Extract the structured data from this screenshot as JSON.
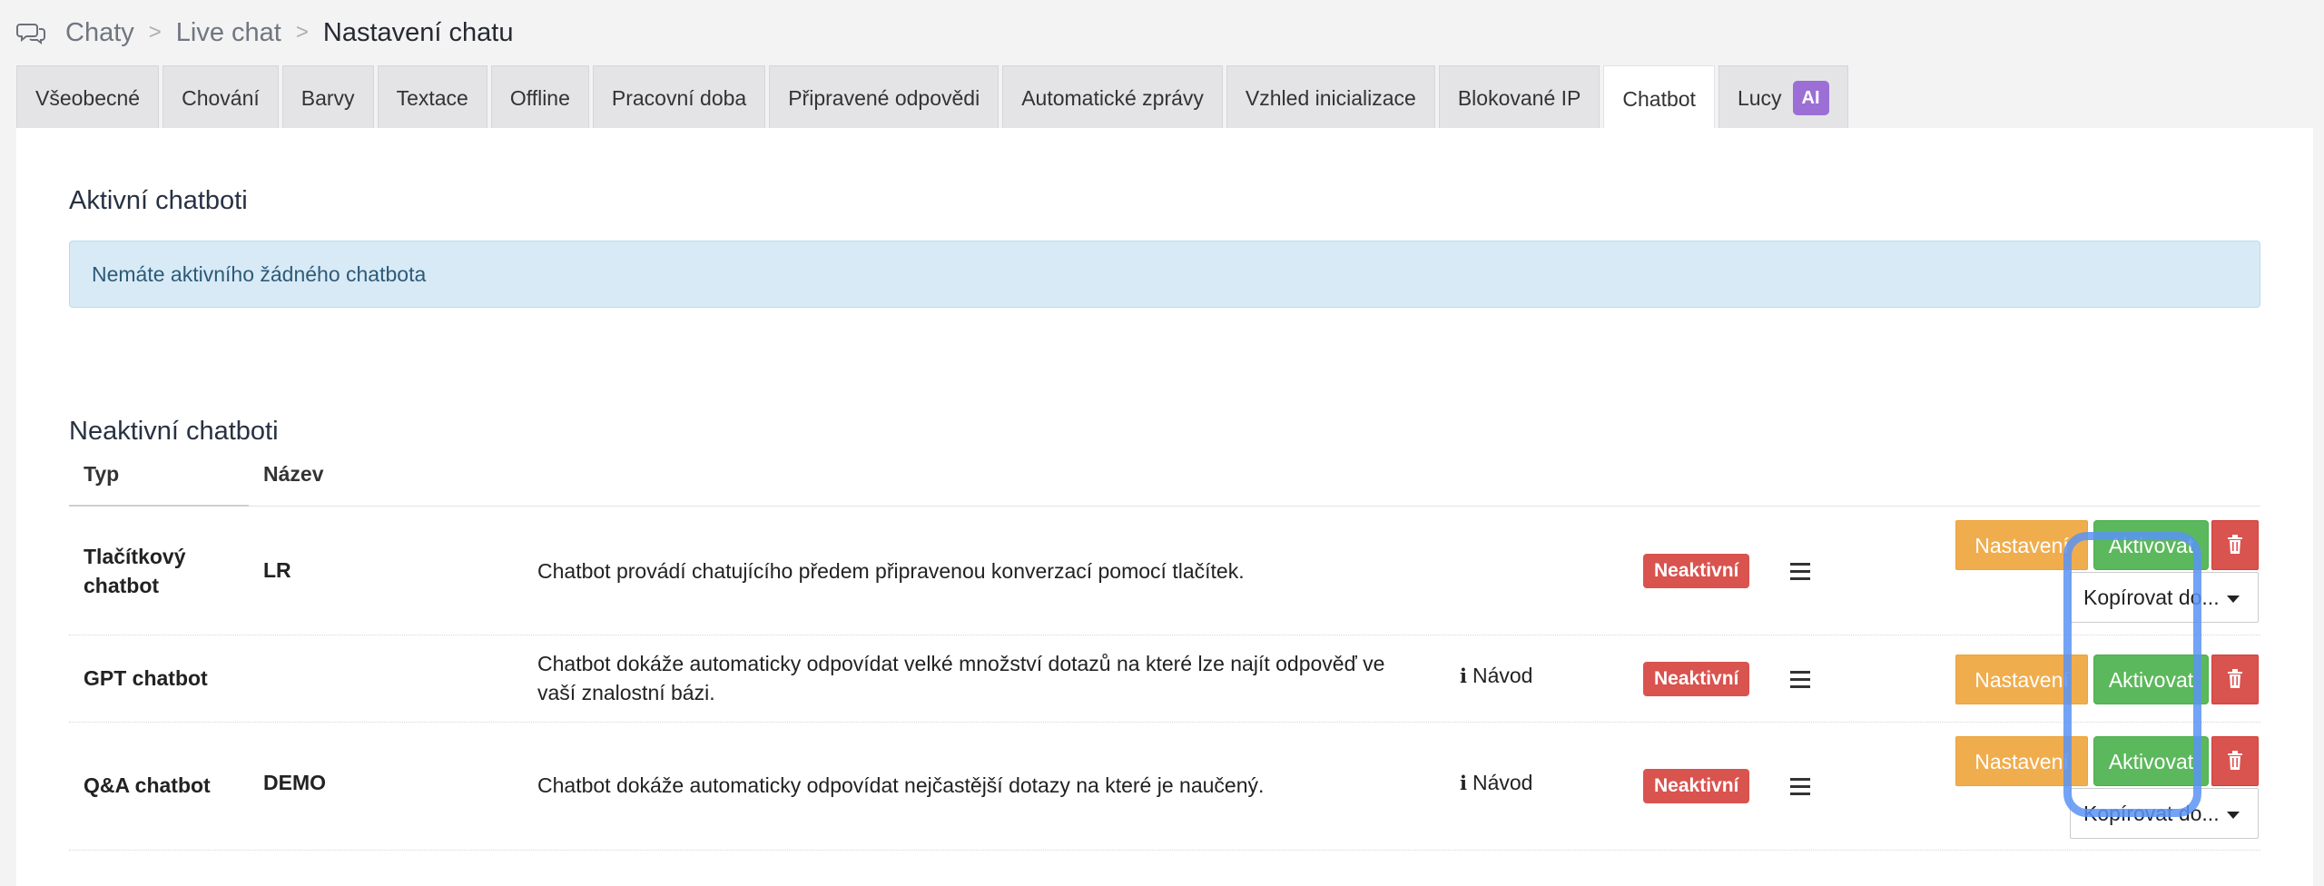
{
  "breadcrumb": {
    "items": [
      "Chaty",
      "Live chat"
    ],
    "current": "Nastavení chatu",
    "separator": ">"
  },
  "tabs": [
    {
      "label": "Všeobecné"
    },
    {
      "label": "Chování"
    },
    {
      "label": "Barvy"
    },
    {
      "label": "Textace"
    },
    {
      "label": "Offline"
    },
    {
      "label": "Pracovní doba"
    },
    {
      "label": "Připravené odpovědi"
    },
    {
      "label": "Automatické zprávy"
    },
    {
      "label": "Vzhled inicializace"
    },
    {
      "label": "Blokované IP"
    },
    {
      "label": "Chatbot",
      "active": true
    },
    {
      "label": "Lucy",
      "badge": "AI"
    }
  ],
  "active_section": {
    "title": "Aktivní chatboti",
    "alert": "Nemáte aktivního žádného chatbota"
  },
  "inactive_section": {
    "title": "Neaktivní chatboti",
    "columns": [
      "Typ",
      "Název"
    ],
    "rows": [
      {
        "type_line1": "Tlačítkový",
        "type_line2": "chatbot",
        "name": "LR",
        "description_line1": "Chatbot provádí chatujícího předem připravenou konverzací pomocí tlačítek.",
        "description_line2": "",
        "guide": "",
        "status": "Neaktivní",
        "settings_label": "Nastavení",
        "activate_label": "Aktivovat",
        "copy_label": "Kopírovat do..."
      },
      {
        "type_line1": "GPT chatbot",
        "type_line2": "",
        "name": "",
        "description_line1": "Chatbot dokáže automaticky odpovídat velké množství dotazů na které lze najít odpověď ve",
        "description_line2": "vaší znalostní bázi.",
        "guide": "Návod",
        "status": "Neaktivní",
        "settings_label": "Nastavení",
        "activate_label": "Aktivovat",
        "copy_label": ""
      },
      {
        "type_line1": "Q&A chatbot",
        "type_line2": "",
        "name": "DEMO",
        "description_line1": "Chatbot dokáže automaticky odpovídat nejčastější dotazy na které je naučený.",
        "description_line2": "",
        "guide": "Návod",
        "status": "Neaktivní",
        "settings_label": "Nastavení",
        "activate_label": "Aktivovat",
        "copy_label": "Kopírovat do..."
      }
    ]
  },
  "colors": {
    "settings": "#f0ad4e",
    "activate": "#5cb85c",
    "danger": "#d9534f",
    "ai_badge": "#9c6fd6",
    "alert_bg": "#d8eaf6",
    "highlight": "#5b93f5"
  },
  "icons": {
    "breadcrumb": "chat-bubbles-icon",
    "info": "info-icon",
    "menu": "hamburger-icon",
    "delete": "trash-icon",
    "dropdown": "caret-down-icon"
  }
}
